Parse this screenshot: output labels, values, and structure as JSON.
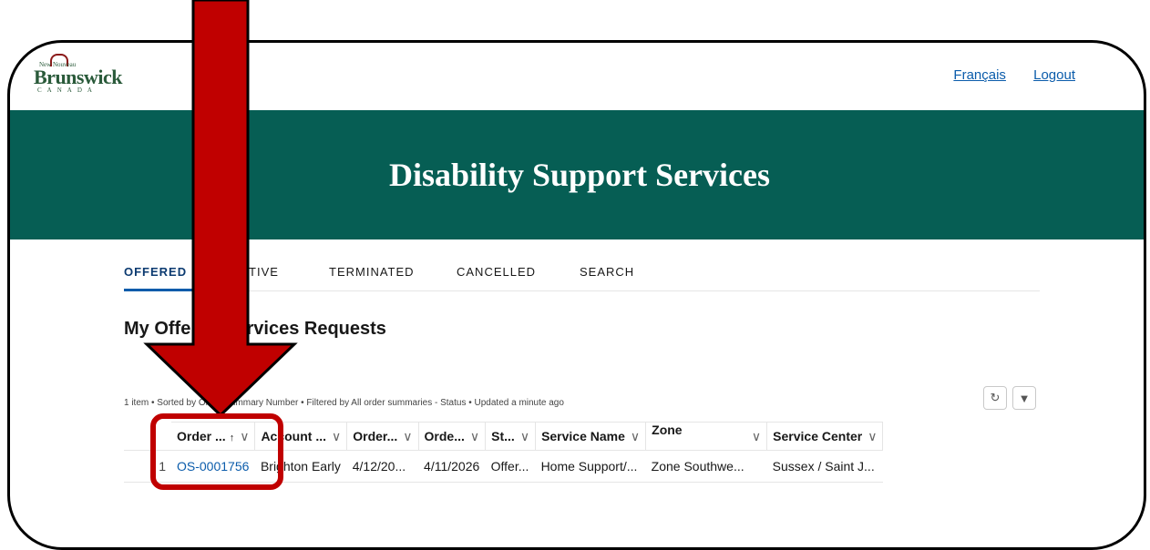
{
  "header": {
    "logo_top": "New Nouveau",
    "logo_main": "Brunswick",
    "logo_sub": "CANADA",
    "links": [
      "Français",
      "Logout"
    ]
  },
  "banner": {
    "title": "Disability Support Services"
  },
  "tabs": [
    "OFFERED",
    "ACTIVE",
    "TERMINATED",
    "CANCELLED",
    "SEARCH"
  ],
  "section_title": "My Offered Services Requests",
  "list_meta": "1 item • Sorted by Order Summary Number • Filtered by All order summaries - Status • Updated a minute ago",
  "table": {
    "columns": [
      "Order ...",
      "Account ...",
      "Order...",
      "Orde...",
      "St...",
      "Service Name",
      "Zone",
      "Service Center"
    ],
    "rows": [
      {
        "num": "1",
        "cells": [
          "OS-0001756",
          "Brighton Early",
          "4/12/20...",
          "4/11/2026",
          "Offer...",
          "Home Support/...",
          "Zone Southwe...",
          "Sussex / Saint J..."
        ]
      }
    ]
  },
  "colors": {
    "banner": "#065e54",
    "link": "#0b5cab",
    "annotation": "#c00000"
  },
  "icons": [
    "refresh-icon",
    "filter-icon",
    "sort-ascending-icon",
    "chevron-down-icon"
  ]
}
